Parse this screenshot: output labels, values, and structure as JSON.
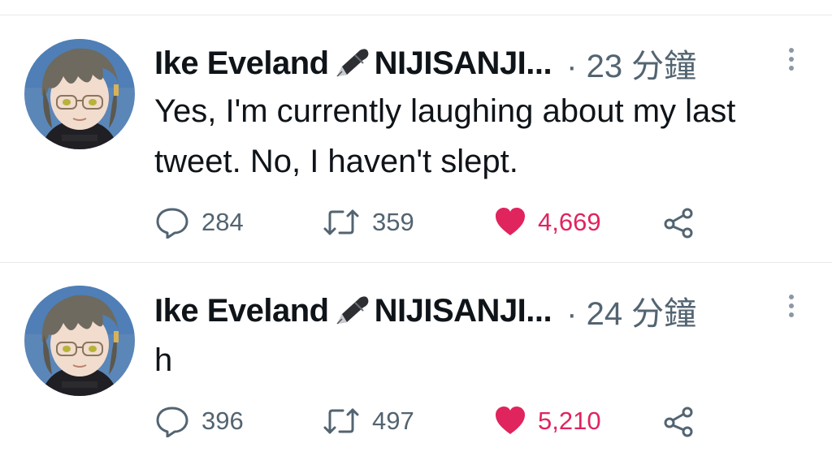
{
  "tweets": [
    {
      "author": "Ike Eveland",
      "author_suffix": "NIJISANJI...",
      "time": "· 23 分鐘",
      "text": "Yes, I'm currently laughing about my last tweet. No, I haven't slept.",
      "replies": "284",
      "retweets": "359",
      "likes": "4,669",
      "liked": true
    },
    {
      "author": "Ike Eveland",
      "author_suffix": "NIJISANJI...",
      "time": "· 24 分鐘",
      "text": "h",
      "replies": "396",
      "retweets": "497",
      "likes": "5,210",
      "liked": true
    }
  ],
  "icons": {
    "reply": "reply-icon",
    "retweet": "retweet-icon",
    "like": "heart-icon",
    "share": "share-icon",
    "more": "more-vertical-icon",
    "pen": "fountain-pen-icon"
  },
  "colors": {
    "like": "#e0245e",
    "muted": "#536471",
    "text": "#0f1419",
    "divider": "#e6e9ec"
  }
}
